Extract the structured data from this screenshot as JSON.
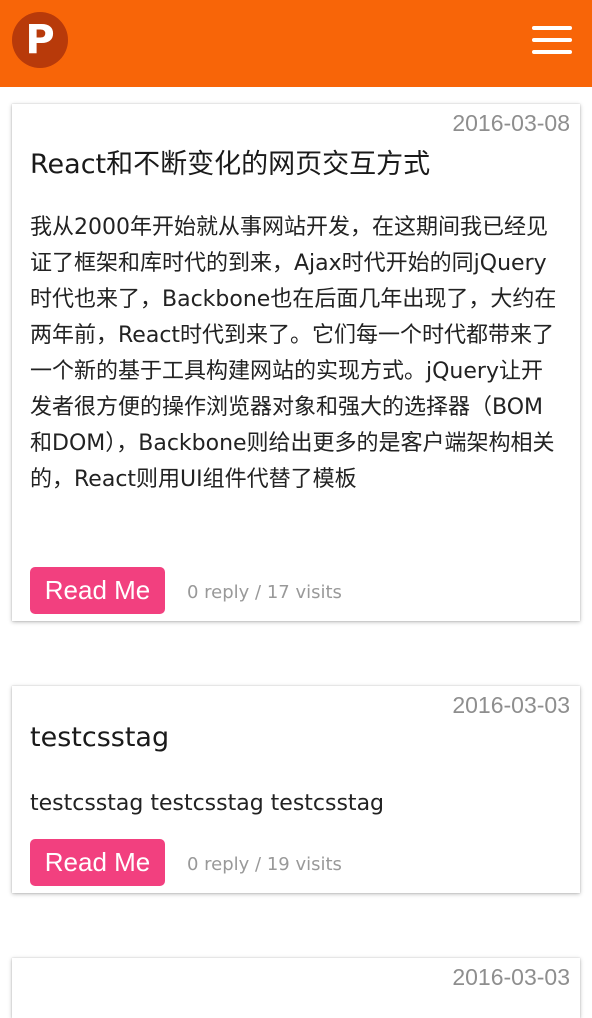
{
  "header": {
    "logo_letter": "P",
    "bar_color": "#f86508",
    "menu_icon": "hamburger-menu-icon"
  },
  "posts": [
    {
      "date": "2016-03-08",
      "title": "React和不断变化的网页交互方式",
      "excerpt": "我从2000年开始就从事网站开发，在这期间我已经见证了框架和库时代的到来，Ajax时代开始的同jQuery时代也来了，Backbone也在后面几年出现了，大约在两年前，React时代到来了。它们每一个时代都带来了一个新的基于工具构建网站的实现方式。jQuery让开发者很方便的操作浏览器对象和强大的选择器（BOM和DOM），Backbone则给出更多的是客户端架构相关的，React则用UI组件代替了模板",
      "button_label": "Read Me",
      "stats": "0 reply / 17 visits"
    },
    {
      "date": "2016-03-03",
      "title": "testcsstag",
      "excerpt": "testcsstag testcsstag testcsstag",
      "button_label": "Read Me",
      "stats": "0 reply / 19 visits"
    },
    {
      "date": "2016-03-03"
    }
  ],
  "colors": {
    "button": "#f2407f",
    "date": "#8e8e8e",
    "stats": "#999999"
  }
}
